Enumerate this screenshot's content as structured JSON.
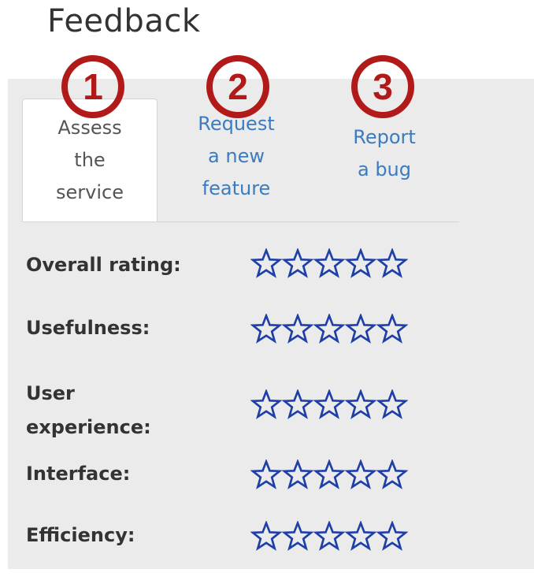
{
  "header": {
    "title": "Feedback"
  },
  "badges": [
    "1",
    "2",
    "3"
  ],
  "tabs": [
    {
      "lines": [
        "Assess",
        "the",
        "service"
      ],
      "active": true
    },
    {
      "lines": [
        "Request",
        "a new",
        "feature"
      ],
      "active": false
    },
    {
      "lines": [
        "Report",
        "a bug"
      ],
      "active": false
    }
  ],
  "ratings": [
    {
      "label_lines": [
        "Overall rating:"
      ],
      "stars": 5,
      "filled": 0
    },
    {
      "label_lines": [
        "Usefulness:"
      ],
      "stars": 5,
      "filled": 0
    },
    {
      "label_lines": [
        "User",
        "experience:"
      ],
      "stars": 5,
      "filled": 0
    },
    {
      "label_lines": [
        "Interface:"
      ],
      "stars": 5,
      "filled": 0
    },
    {
      "label_lines": [
        "Efficiency:"
      ],
      "stars": 5,
      "filled": 0
    }
  ],
  "colors": {
    "accent_link": "#3a7cc1",
    "star_outline": "#1f3fa8",
    "badge": "#b21a1a",
    "panel_bg": "#ebebeb"
  },
  "icons": {
    "star": "star-outline-icon"
  }
}
